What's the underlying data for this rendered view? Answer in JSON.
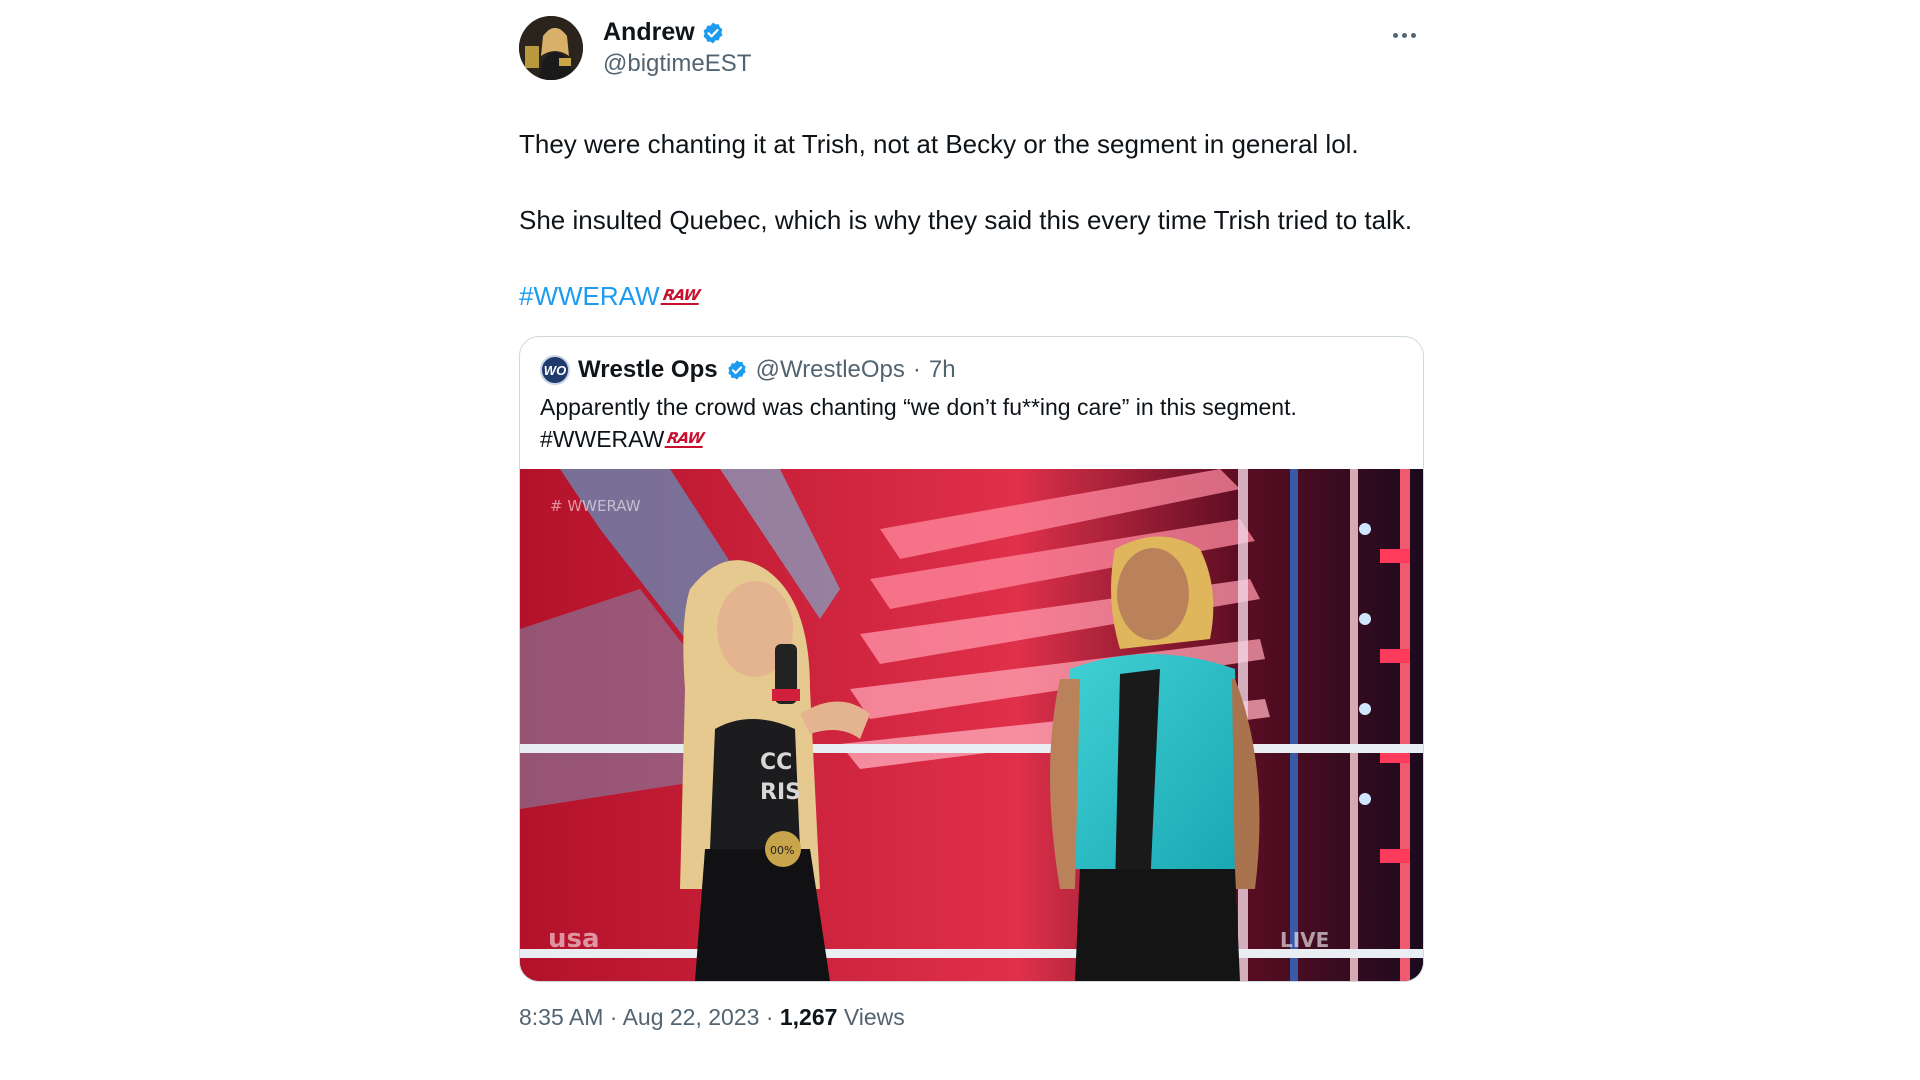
{
  "tweet": {
    "author": {
      "display_name": "Andrew",
      "handle": "@bigtimeEST",
      "verified": true
    },
    "paragraphs": [
      "They were chanting it at Trish, not at Becky or the segment in general lol.",
      "She insulted Quebec, which is why they said this every time Trish tried to talk."
    ],
    "hashtag": "#WWERAW",
    "hashtag_emoji_label": "RAW",
    "more_icon": "ellipsis-icon",
    "footer": {
      "time": "8:35 AM",
      "separator1": "·",
      "date": "Aug 22, 2023",
      "separator2": "·",
      "views_count": "1,267",
      "views_label": "Views"
    }
  },
  "quoted_tweet": {
    "avatar_text": "WO",
    "display_name": "Wrestle Ops",
    "verified": true,
    "handle": "@WrestleOps",
    "dot": "·",
    "time": "7h",
    "text": "Apparently the crowd was chanting “we don’t fu**ing care” in this segment.",
    "hashtag": "#WWERAW",
    "hashtag_emoji_label": "RAW",
    "media": {
      "overlay_hashtag": "# WWERAW",
      "network_bug": "usa",
      "live_bug": "LIVE",
      "shirt_text_line1": "CC",
      "shirt_text_line2": "RIS",
      "belt_text": "00%"
    }
  },
  "colors": {
    "accent_blue": "#1d9bf0",
    "secondary_text": "#536471",
    "primary_text": "#0f1419",
    "raw_red": "#c8102e",
    "border": "#cfd9de"
  }
}
